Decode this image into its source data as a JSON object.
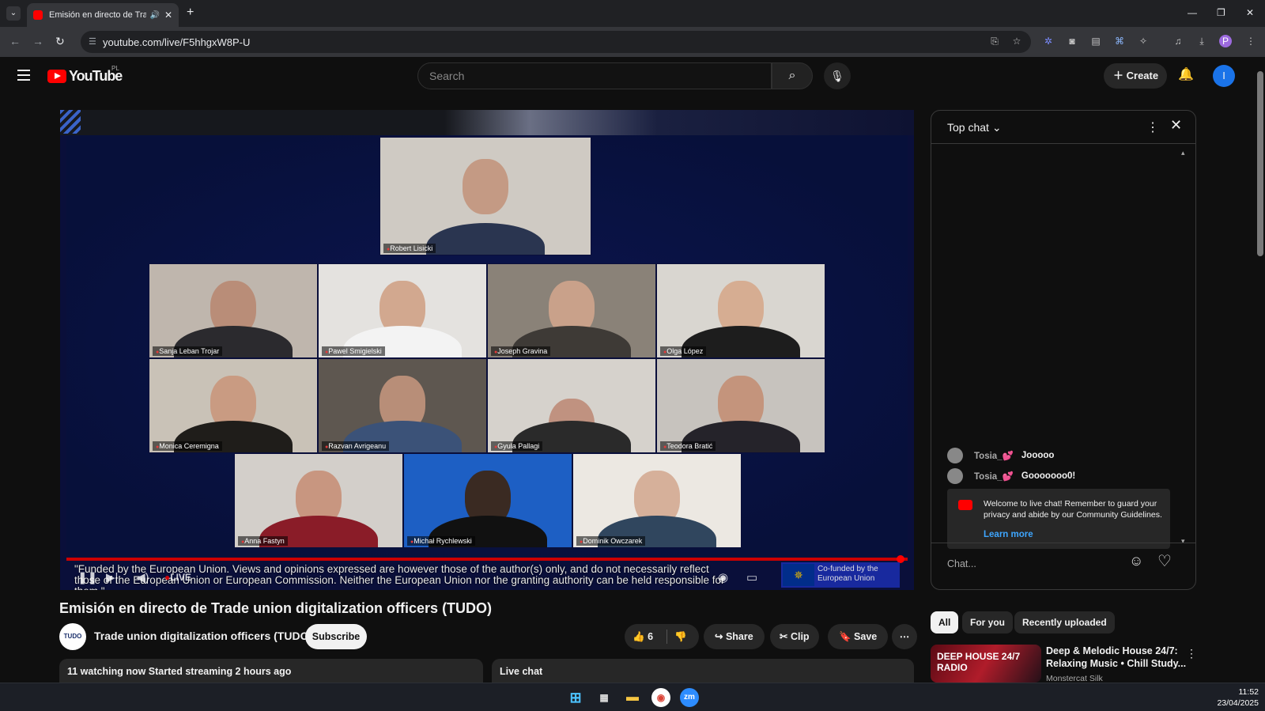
{
  "browser": {
    "tab_title": "Emisión en directo de Trade",
    "url": "youtube.com/live/F5hhgxW8P-U",
    "new_tab": "+",
    "profile_initial": "P"
  },
  "youtube": {
    "logo": "YouTube",
    "country": "PL",
    "search_placeholder": "Search",
    "create_label": "Create",
    "avatar_initial": "I"
  },
  "video": {
    "participants": [
      {
        "name": "Robert Lisicki"
      },
      {
        "name": "Sanja Leban Trojar"
      },
      {
        "name": "Pawel Smigielski"
      },
      {
        "name": "Joseph Gravina"
      },
      {
        "name": "Olga López"
      },
      {
        "name": "Monica Ceremigna"
      },
      {
        "name": "Razvan Avrigeanu"
      },
      {
        "name": "Gyula Pallagi"
      },
      {
        "name": "Teodora Bratić"
      },
      {
        "name": "Anna Fastyn"
      },
      {
        "name": "Michał Rychlewski"
      },
      {
        "name": "Dominik Owczarek"
      }
    ],
    "caption": "\"Funded by the European Union. Views and opinions expressed are however those of the author(s) only, and do not necessarily reflect those of the European Union or European Commission. Neither the European Union nor the granting authority can be held responsible for them.\"",
    "live_label": "LIVE",
    "eu_banner": "Co-funded by the European Union",
    "title": "Emisión en directo de Trade union digitalization officers (TUDO)",
    "channel_logo": "TUDO",
    "channel_name": "Trade union digitalization officers (TUDO)",
    "subscribe_label": "Subscribe",
    "likes": "6",
    "share_label": "Share",
    "clip_label": "Clip",
    "save_label": "Save",
    "meta": "11 watching now  Started streaming 2 hours ago",
    "live_chat_label": "Live chat",
    "progress": 1.0
  },
  "chat": {
    "mode": "Top chat",
    "messages": [
      {
        "user": "Tosia_💕",
        "text": "Jooooo"
      },
      {
        "user": "Tosia_💕",
        "text": "Gooooooo0!"
      }
    ],
    "welcome": "Welcome to live chat! Remember to guard your privacy and abide by our Community Guidelines.",
    "learn_more": "Learn more",
    "input_placeholder": "Chat..."
  },
  "recommendations": {
    "chips": [
      "All",
      "For you",
      "Recently uploaded"
    ],
    "active_chip": "All",
    "item": {
      "thumb_text": "DEEP HOUSE 24/7 RADIO",
      "title": "Deep & Melodic House 24/7: Relaxing Music • Chill Study...",
      "channel": "Monstercat Silk"
    }
  },
  "taskbar": {
    "time": "11:52",
    "date": "23/04/2025"
  }
}
